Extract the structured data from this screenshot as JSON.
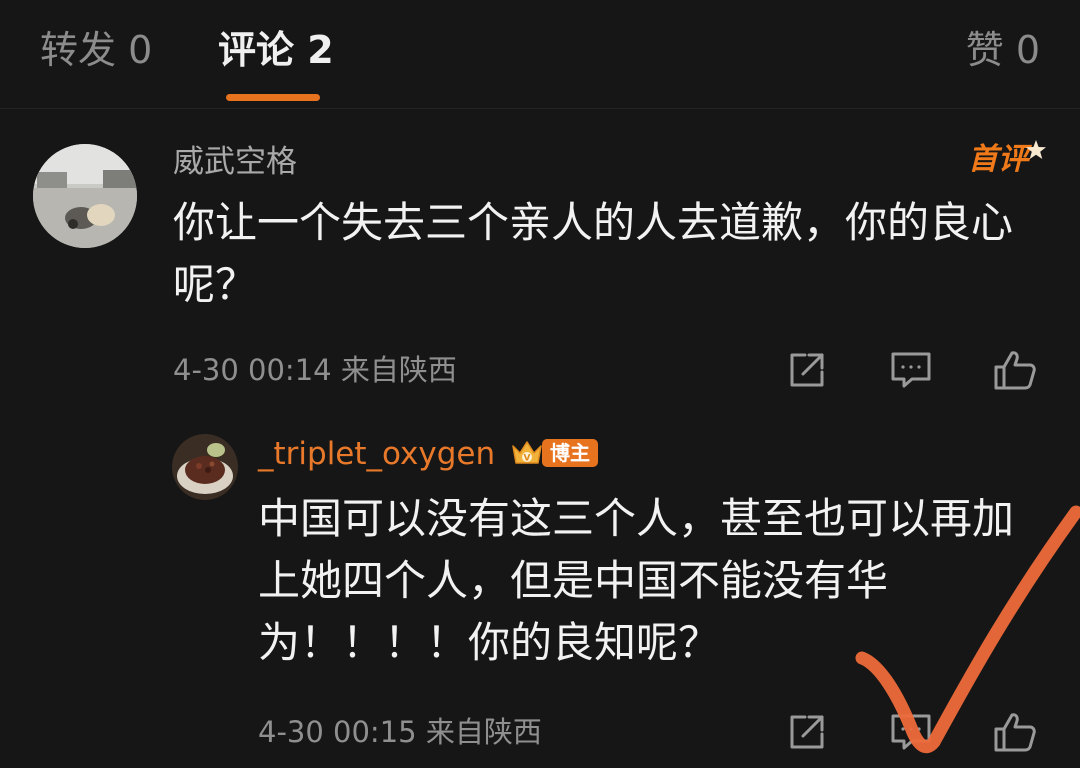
{
  "tabs": {
    "forward": "转发 0",
    "comments": "评论 2",
    "likes": "赞 0"
  },
  "comment": {
    "username": "威武空格",
    "badge": "首评",
    "text": "你让一个失去三个亲人的人去道歉，你的良心呢？",
    "time": "4-30 00:14",
    "location": "来自陕西"
  },
  "reply": {
    "username": "_triplet_oxygen",
    "badge": "博主",
    "text": "中国可以没有这三个人，甚至也可以再加上她四个人，但是中国不能没有华为！！！！你的良知呢？",
    "time": "4-30 00:15",
    "location": "来自陕西"
  },
  "icons": [
    "share-icon",
    "reply-icon",
    "like-icon",
    "crown-icon",
    "star-icon"
  ],
  "colors": {
    "background": "#161616",
    "accent": "#e8731f",
    "text": "#f2f2f2",
    "muted": "#8f8f8f"
  }
}
